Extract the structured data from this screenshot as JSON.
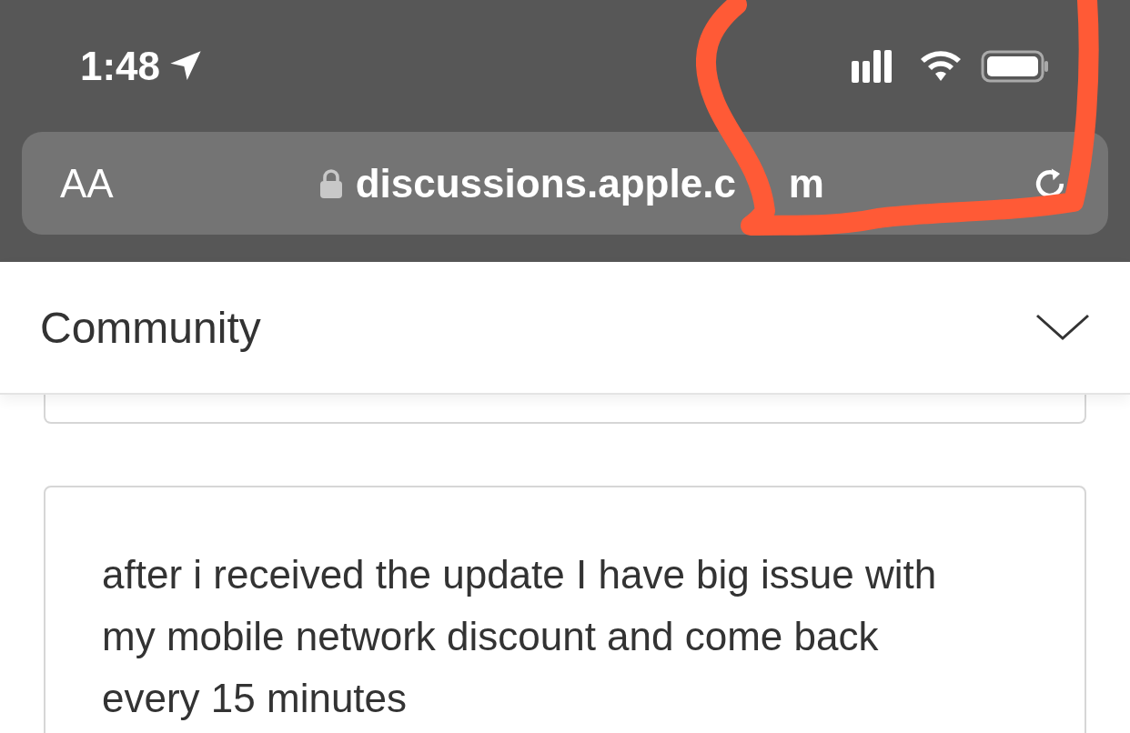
{
  "status_bar": {
    "time": "1:48"
  },
  "address_bar": {
    "text_size_button": "AA",
    "url": "discussions.apple.c",
    "url_tail": "m"
  },
  "header": {
    "title": "Community",
    "expanded": false
  },
  "posts": [
    {
      "kind": "cut"
    },
    {
      "kind": "full",
      "text": "after i received the update I have big issue with my mobile network discount and come back every 15 minutes"
    }
  ]
}
